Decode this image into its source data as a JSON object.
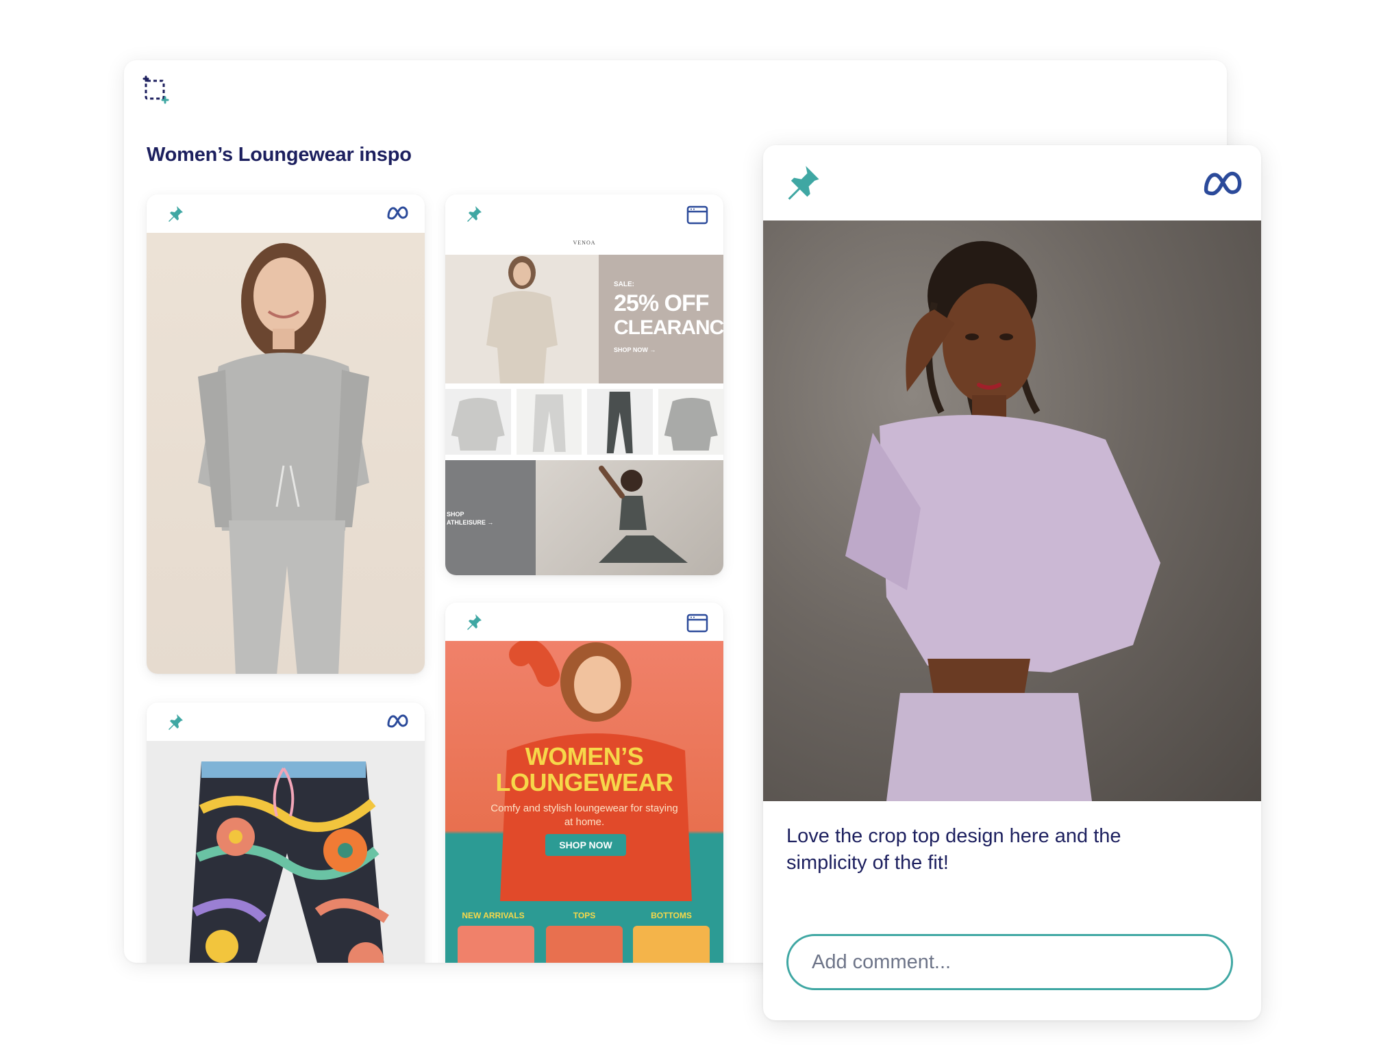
{
  "board": {
    "title": "Women’s Loungewear inspo"
  },
  "cards": {
    "venoa": {
      "brand": "VENOA",
      "sale_label": "SALE:",
      "headline_1": "25% OFF",
      "headline_2": "CLEARANCE",
      "cta": "SHOP NOW →",
      "athleisure_1": "SHOP",
      "athleisure_2": "ATHLEISURE →"
    },
    "loungewear": {
      "headline_1": "WOMEN’S",
      "headline_2": "LOUNGEWEAR",
      "sub_1": "Comfy and stylish loungewear for staying",
      "sub_2": "at home.",
      "cta": "SHOP NOW",
      "cat_1": "NEW ARRIVALS",
      "cat_2": "TOPS",
      "cat_3": "BOTTOMS"
    }
  },
  "detail": {
    "comment": "Love the crop top design here and the simplicity of the fit!",
    "add_comment_placeholder": "Add comment..."
  },
  "icons": {
    "pin": "pushpin-icon",
    "meta": "meta-logo-icon",
    "browser": "browser-window-icon",
    "crop": "crop-add-icon"
  },
  "colors": {
    "navy": "#1c1f5e",
    "teal": "#3fa7a3",
    "meta_blue": "#2b4a9a"
  }
}
